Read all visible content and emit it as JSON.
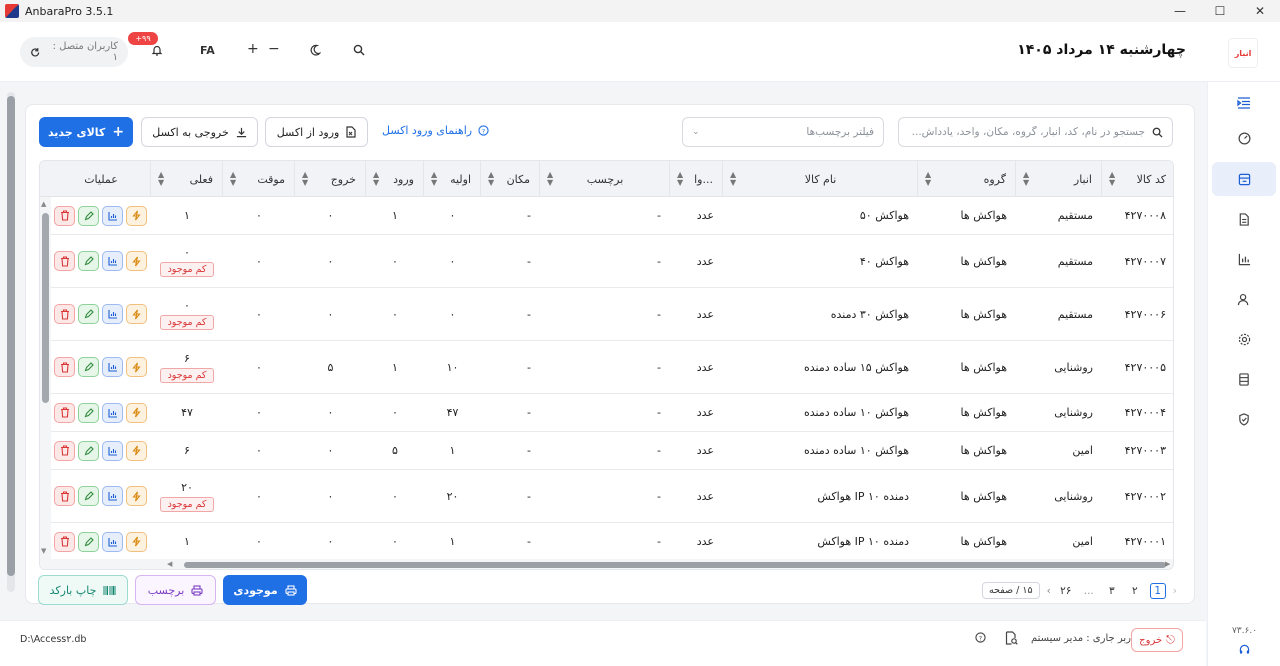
{
  "window": {
    "title": "AnbaraPro 3.5.1",
    "minimize": "—",
    "maximize": "☐",
    "close": "✕"
  },
  "header": {
    "logo": {
      "line1": "انبار",
      "line2": ""
    },
    "date": "چهارشنبه ۱۴ مرداد ۱۴۰۵",
    "online_users": "کاربران متصل : ۱",
    "notify_count": "+۹۹",
    "lang": "FA",
    "zoom_in": "+",
    "zoom_out": "−"
  },
  "toolbar": {
    "new_item": "کالای جدید",
    "export_excel": "خروجی به اکسل",
    "import_excel": "ورود از اکسل",
    "import_guide": "راهنمای ورود اکسل",
    "tag_filter_placeholder": "فیلتر برچسب‌ها",
    "search_placeholder": "جستجو در نام، کد، انبار، گروه، مکان، واحد، یادداش..."
  },
  "table": {
    "headers": {
      "code": "کد کالا",
      "warehouse": "انبار",
      "group": "گروه",
      "name": "نام کالا",
      "unit": "وا...",
      "tag": "برچسب",
      "location": "مکان",
      "initial": "اولیه",
      "in": "ورود",
      "out": "خروج",
      "temp": "موقت",
      "current": "فعلی",
      "actions": "عملیات"
    },
    "low_stock_label": "کم موجود",
    "rows": [
      {
        "code": "۴۲۷۰۰۰۸",
        "warehouse": "مستقیم",
        "group": "هواکش ها",
        "name": "هواکش ۵۰",
        "unit": "عدد",
        "tag": "-",
        "location": "-",
        "initial": "۰",
        "in": "۱",
        "out": "۰",
        "temp": "۰",
        "current": "۱",
        "low": false
      },
      {
        "code": "۴۲۷۰۰۰۷",
        "warehouse": "مستقیم",
        "group": "هواکش ها",
        "name": "هواکش ۴۰",
        "unit": "عدد",
        "tag": "-",
        "location": "-",
        "initial": "۰",
        "in": "۰",
        "out": "۰",
        "temp": "۰",
        "current": "۰",
        "low": true
      },
      {
        "code": "۴۲۷۰۰۰۶",
        "warehouse": "مستقیم",
        "group": "هواکش ها",
        "name": "هواکش ۳۰ دمنده",
        "unit": "عدد",
        "tag": "-",
        "location": "-",
        "initial": "۰",
        "in": "۰",
        "out": "۰",
        "temp": "۰",
        "current": "۰",
        "low": true
      },
      {
        "code": "۴۲۷۰۰۰۵",
        "warehouse": "روشنایی",
        "group": "هواکش ها",
        "name": "هواکش ۱۵ ساده دمنده",
        "unit": "عدد",
        "tag": "-",
        "location": "-",
        "initial": "۱۰",
        "in": "۱",
        "out": "۵",
        "temp": "۰",
        "current": "۶",
        "low": true
      },
      {
        "code": "۴۲۷۰۰۰۴",
        "warehouse": "روشنایی",
        "group": "هواکش ها",
        "name": "هواکش ۱۰ ساده دمنده",
        "unit": "عدد",
        "tag": "-",
        "location": "-",
        "initial": "۴۷",
        "in": "۰",
        "out": "۰",
        "temp": "۰",
        "current": "۴۷",
        "low": false
      },
      {
        "code": "۴۲۷۰۰۰۳",
        "warehouse": "امین",
        "group": "هواکش ها",
        "name": "هواکش ۱۰ ساده دمنده",
        "unit": "عدد",
        "tag": "-",
        "location": "-",
        "initial": "۱",
        "in": "۵",
        "out": "۰",
        "temp": "۰",
        "current": "۶",
        "low": false
      },
      {
        "code": "۴۲۷۰۰۰۲",
        "warehouse": "روشنایی",
        "group": "هواکش ها",
        "name": "هواکش IP ۱۰ دمنده",
        "unit": "عدد",
        "tag": "-",
        "location": "-",
        "initial": "۲۰",
        "in": "۰",
        "out": "۰",
        "temp": "۰",
        "current": "۲۰",
        "low": true
      },
      {
        "code": "۴۲۷۰۰۰۱",
        "warehouse": "امین",
        "group": "هواکش ها",
        "name": "هواکش IP ۱۰ دمنده",
        "unit": "عدد",
        "tag": "-",
        "location": "-",
        "initial": "۱",
        "in": "۰",
        "out": "۰",
        "temp": "۰",
        "current": "۱",
        "low": false
      }
    ]
  },
  "bottom_buttons": {
    "stock": "موجودی",
    "label": "برچسب",
    "barcode": "چاپ بارکد"
  },
  "pager": {
    "pages": [
      "1",
      "۲",
      "۳",
      "...",
      "۲۶"
    ],
    "page_size": "۱۵ / صفحه"
  },
  "footer": {
    "db_path": "D:\\Access۲.db",
    "current_user": "کاربر جاری : مدیر سیستم",
    "logout": "خروج"
  },
  "sidebar": {
    "version": "۷۳.۶.۰"
  }
}
